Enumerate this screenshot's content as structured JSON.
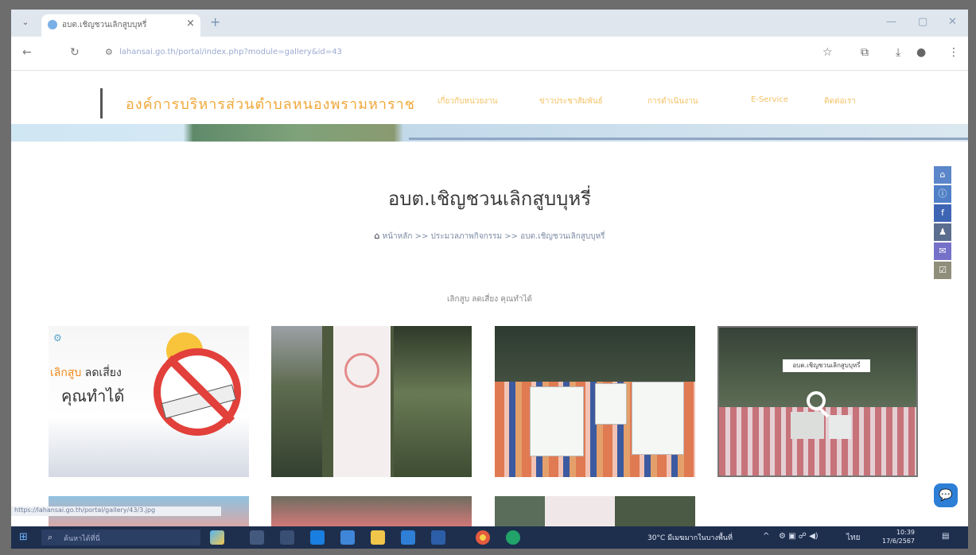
{
  "browser": {
    "tab_title": "อบต.เชิญชวนเลิกสูบบุหรี่",
    "tab_close": "×",
    "new_tab": "+",
    "url": "lahansai.go.th/portal/index.php?module=gallery&id=43",
    "icons": {
      "minimize": "—",
      "maximize": "▢",
      "close": "✕"
    }
  },
  "site": {
    "org_name": "องค์การบริหารส่วนตำบลหนองพรามหาราช",
    "nav": [
      "เกี่ยวกับหน่วยงาน",
      "ข่าวประชาสัมพันธ์",
      "การดำเนินงาน",
      "E-Service",
      "ติดต่อเรา"
    ]
  },
  "page": {
    "title": "อบต.เชิญชวนเลิกสูบบุหรี่",
    "breadcrumb": "หน้าหลัก >> ประมวลภาพกิจกรรม >> อบต.เชิญชวนเลิกสูบบุหรี่",
    "gallery_caption": "เลิกสูบ ลดเสี่ยง คุณทำได้"
  },
  "gallery": {
    "poster_text_1a": "เลิกสูบ",
    "poster_text_1b": "ลดเสี่ยง",
    "poster_text_2": "คุณทำได้",
    "hover_label": "อบต.เชิญชวนเลิกสูบบุหรี่"
  },
  "status_bar_url": "https://lahansai.go.th/portal/gallery/43/3.jpg",
  "taskbar": {
    "search_placeholder": "ค้นหาได้ที่นี่",
    "weather": "30°C มีเมฆมากในบางพื้นที่",
    "lang": "ไทย",
    "time": "10:39",
    "date": "17/6/2567"
  },
  "colors": {
    "accent": "#f0a83a",
    "nav": "#f4c266",
    "taskbar": "#1e2f4e"
  }
}
